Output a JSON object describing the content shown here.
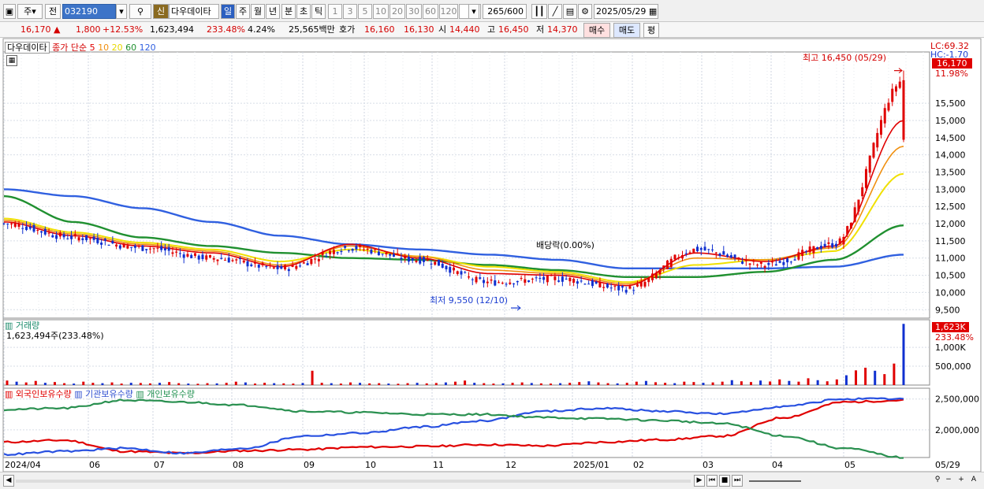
{
  "toolbar": {
    "market_label": "주",
    "prev_label": "전",
    "code": "032190",
    "new_badge": "신",
    "company": "다우데이타",
    "periods": [
      "일",
      "주",
      "월",
      "년",
      "분",
      "초",
      "틱"
    ],
    "intervals": [
      "1",
      "3",
      "5",
      "10",
      "20",
      "30",
      "60",
      "120"
    ],
    "count": "265",
    "count_total": "/600",
    "date": "2025/05/29"
  },
  "quote": {
    "price": "16,170",
    "change": "1,800",
    "change_pct": "+12.53%",
    "volume": "1,623,494",
    "vol_ratio": "233.48%",
    "rate": "4.24%",
    "amount": "25,565백만",
    "ask_label": "호가",
    "ask1": "16,160",
    "ask2": "16,130",
    "open_label": "시",
    "open": "14,440",
    "high_label": "고",
    "high": "16,450",
    "low_label": "저",
    "low": "14,370",
    "buy_label": "매수",
    "sell_label": "매도",
    "eval_label": "평"
  },
  "price_legend": {
    "name": "다우데이타",
    "ma_label": "종가 단순",
    "ma_periods": [
      "5",
      "10",
      "20",
      "60",
      "120"
    ],
    "lc": "LC:69.32",
    "hc": "HC:-1.70",
    "last_price": "16,170",
    "last_pct": "11.98%",
    "high_annotation": "최고 16,450 (05/29)",
    "low_annotation": "최저 9,550 (12/10)",
    "dividend_annotation": "배당락(0.00%)"
  },
  "volume_legend": {
    "name": "거래량",
    "value": "1,623,494주(233.48%)",
    "last": "1,623K",
    "last_pct": "233.48%"
  },
  "holding_legend": {
    "foreign": "외국인보유수량",
    "institution": "기관보유수량",
    "individual": "개인보유수량"
  },
  "xaxis_labels": [
    "2024/04",
    "06",
    "07",
    "08",
    "09",
    "10",
    "11",
    "12",
    "2025/01",
    "02",
    "03",
    "04",
    "05"
  ],
  "xaxis_end": "05/29",
  "colors": {
    "up": "#e00000",
    "down": "#1030d0",
    "ma5": "#e00000",
    "ma10": "#f09010",
    "ma20": "#f0e000",
    "ma60": "#209030",
    "ma120": "#3060e0"
  },
  "chart_data": [
    {
      "type": "line",
      "title": "다우데이타",
      "x": [
        "2024/04",
        "06",
        "07",
        "08",
        "09",
        "10",
        "11",
        "12",
        "2025/01",
        "02",
        "03",
        "04",
        "05",
        "05/29"
      ],
      "yticks": [
        "16,170",
        "15,500",
        "15,000",
        "14,500",
        "14,000",
        "13,500",
        "13,000",
        "12,500",
        "12,000",
        "11,500",
        "11,000",
        "10,500",
        "10,000",
        "9,500"
      ],
      "ylim": [
        9300,
        16900
      ],
      "series": [
        {
          "name": "종가",
          "values": [
            12000,
            11600,
            11300,
            11000,
            10700,
            11300,
            10950,
            10300,
            10400,
            10100,
            11250,
            10800,
            11400,
            16170
          ]
        },
        {
          "name": "5",
          "values": [
            12050,
            11650,
            11350,
            11150,
            10750,
            11400,
            11000,
            10550,
            10500,
            10200,
            11150,
            10900,
            11350,
            15000
          ]
        },
        {
          "name": "10",
          "values": [
            12100,
            11700,
            11400,
            11200,
            10800,
            11350,
            11050,
            10650,
            10550,
            10250,
            11000,
            10950,
            11300,
            14250
          ]
        },
        {
          "name": "20",
          "values": [
            12150,
            11750,
            11450,
            11250,
            10900,
            11250,
            11050,
            10750,
            10600,
            10300,
            10800,
            10950,
            11200,
            13450
          ]
        },
        {
          "name": "60",
          "values": [
            12800,
            12050,
            11600,
            11350,
            11150,
            11000,
            10950,
            10800,
            10650,
            10450,
            10450,
            10600,
            10950,
            11950
          ]
        },
        {
          "name": "120",
          "values": [
            13000,
            12800,
            12450,
            12050,
            11650,
            11400,
            11250,
            11100,
            10950,
            10700,
            10700,
            10700,
            10750,
            11100
          ]
        }
      ]
    },
    {
      "type": "bar",
      "title": "거래량",
      "yticks": [
        "1,623K",
        "1,000K",
        "500,000"
      ],
      "ylim": [
        0,
        1650000
      ],
      "values": [
        120000,
        90000,
        70000,
        110000,
        60000,
        80000,
        50000,
        40000,
        90000,
        60000,
        50000,
        70000,
        40000,
        60000,
        55000,
        45000,
        60000,
        80000,
        50000,
        40000,
        35000,
        50000,
        45000,
        60000,
        90000,
        70000,
        40000,
        60000,
        50000,
        45000,
        40000,
        55000,
        380000,
        60000,
        50000,
        40000,
        70000,
        60000,
        45000,
        50000,
        40000,
        35000,
        50000,
        60000,
        45000,
        55000,
        70000,
        90000,
        120000,
        60000,
        50000,
        40000,
        45000,
        60000,
        70000,
        55000,
        45000,
        40000,
        50000,
        60000,
        80000,
        100000,
        70000,
        50000,
        45000,
        60000,
        90000,
        110000,
        75000,
        60000,
        50000,
        90000,
        80000,
        60000,
        70000,
        90000,
        130000,
        100000,
        80000,
        120000,
        95000,
        150000,
        110000,
        90000,
        180000,
        130000,
        100000,
        150000,
        260000,
        390000,
        460000,
        380000,
        290000,
        570000,
        1623494
      ]
    },
    {
      "type": "line",
      "title": "보유수량",
      "yticks": [
        "2,500,000",
        "2,000,000"
      ],
      "ylim": [
        1550000,
        2650000
      ],
      "series": [
        {
          "name": "외국인보유수량",
          "values": [
            1800000,
            1830000,
            1650000,
            1620000,
            1660000,
            1680000,
            1720000,
            1730000,
            1760000,
            1740000,
            1800000,
            1840000,
            1900000,
            2200000,
            2450000,
            2480000
          ]
        },
        {
          "name": "기관보유수량",
          "values": [
            1600000,
            1650000,
            1700000,
            1620000,
            1700000,
            1900000,
            1950000,
            2050000,
            2150000,
            2300000,
            2350000,
            2300000,
            2260000,
            2380000,
            2500000,
            2500000
          ]
        },
        {
          "name": "개인보유수량",
          "values": [
            2330000,
            2350000,
            2480000,
            2450000,
            2400000,
            2300000,
            2280000,
            2250000,
            2250000,
            2200000,
            2180000,
            2150000,
            2100000,
            1900000,
            1700000,
            1550000
          ]
        }
      ]
    }
  ]
}
